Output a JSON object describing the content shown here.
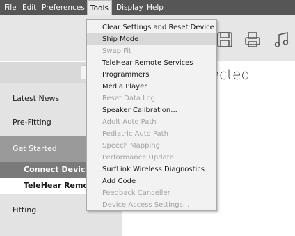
{
  "menubar": {
    "items": [
      "File",
      "Edit",
      "Preferences",
      "Tools",
      "Display",
      "Help"
    ],
    "active": "Tools"
  },
  "toolbar": {
    "icons": [
      "save-icon",
      "print-icon",
      "music-icon"
    ]
  },
  "heading": "ected",
  "sidebar": {
    "items": [
      {
        "label": "Latest News"
      },
      {
        "label": "Pre-Fitting"
      },
      {
        "label": "Get Started"
      },
      {
        "label": "Connect Devices"
      },
      {
        "label": "TeleHear Remote S"
      },
      {
        "label": "Fitting"
      }
    ]
  },
  "tools_menu": {
    "items": [
      {
        "label": "Clear Settings and Reset Device",
        "enabled": true
      },
      {
        "label": "Ship Mode",
        "enabled": true,
        "highlighted": true
      },
      {
        "label": "Swap Fit",
        "enabled": false
      },
      {
        "label": "TeleHear Remote Services",
        "enabled": true
      },
      {
        "label": "Programmers",
        "enabled": true
      },
      {
        "label": "Media Player",
        "enabled": true
      },
      {
        "label": "Reset Data Log",
        "enabled": false
      },
      {
        "label": "Speaker Calibration...",
        "enabled": true
      },
      {
        "label": "Adult Auto Path",
        "enabled": false
      },
      {
        "label": "Pediatric Auto Path",
        "enabled": false
      },
      {
        "label": "Speech Mapping",
        "enabled": false
      },
      {
        "label": "Performance Update",
        "enabled": false
      },
      {
        "label": "SurfLink Wireless Diagnostics",
        "enabled": true
      },
      {
        "label": "Add Code",
        "enabled": true
      },
      {
        "label": "Feedback Canceller",
        "enabled": false
      },
      {
        "label": "Device Access Settings...",
        "enabled": false
      }
    ]
  },
  "colors": {
    "menubar": "#565656",
    "toolbar": "#e6e6e6",
    "sidebar": "#e3e3e3",
    "sidebar_active": "#9a9a9a",
    "sidebar_sub_active": "#7a7a7a",
    "menu_bg": "#f2f2f2",
    "menu_disabled": "#a3a3a3"
  }
}
